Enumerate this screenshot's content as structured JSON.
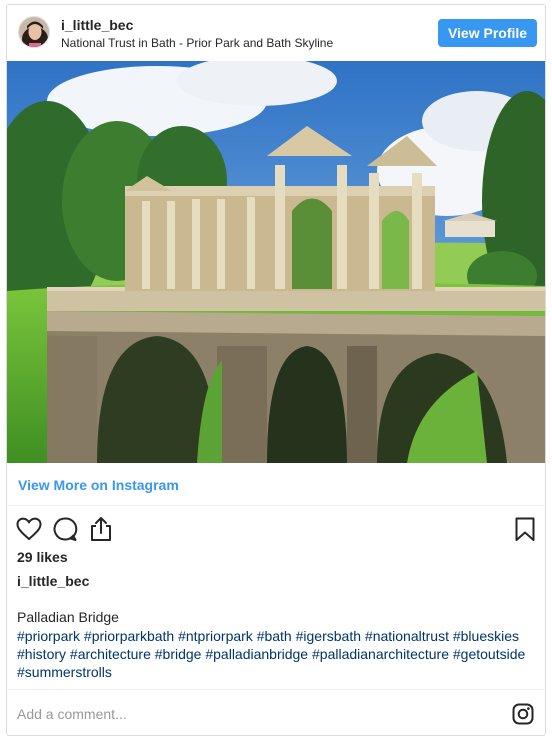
{
  "post": {
    "username": "i_little_bec",
    "location": "National Trust in Bath - Prior Park and Bath Skyline",
    "view_profile_label": "View Profile",
    "view_more_label": "View More on Instagram",
    "likes_text": "29 likes",
    "caption_username": "i_little_bec",
    "caption_text": "Palladian Bridge",
    "hashtags": [
      "#priorpark",
      "#priorparkbath",
      "#ntpriorpark",
      "#bath",
      "#igersbath",
      "#nationaltrust",
      "#blueskies",
      "#history",
      "#architecture",
      "#bridge",
      "#palladianbridge",
      "#palladianarchitecture",
      "#getoutside",
      "#summerstrolls"
    ],
    "comment_placeholder": "Add a comment..."
  },
  "icons": {
    "like": "heart-icon",
    "comment": "comment-bubble-icon",
    "share": "share-icon",
    "save": "bookmark-icon",
    "instagram": "instagram-logo-icon"
  },
  "colors": {
    "accent": "#3897f0",
    "hashtag": "#003569",
    "border": "#dbdbdb"
  }
}
